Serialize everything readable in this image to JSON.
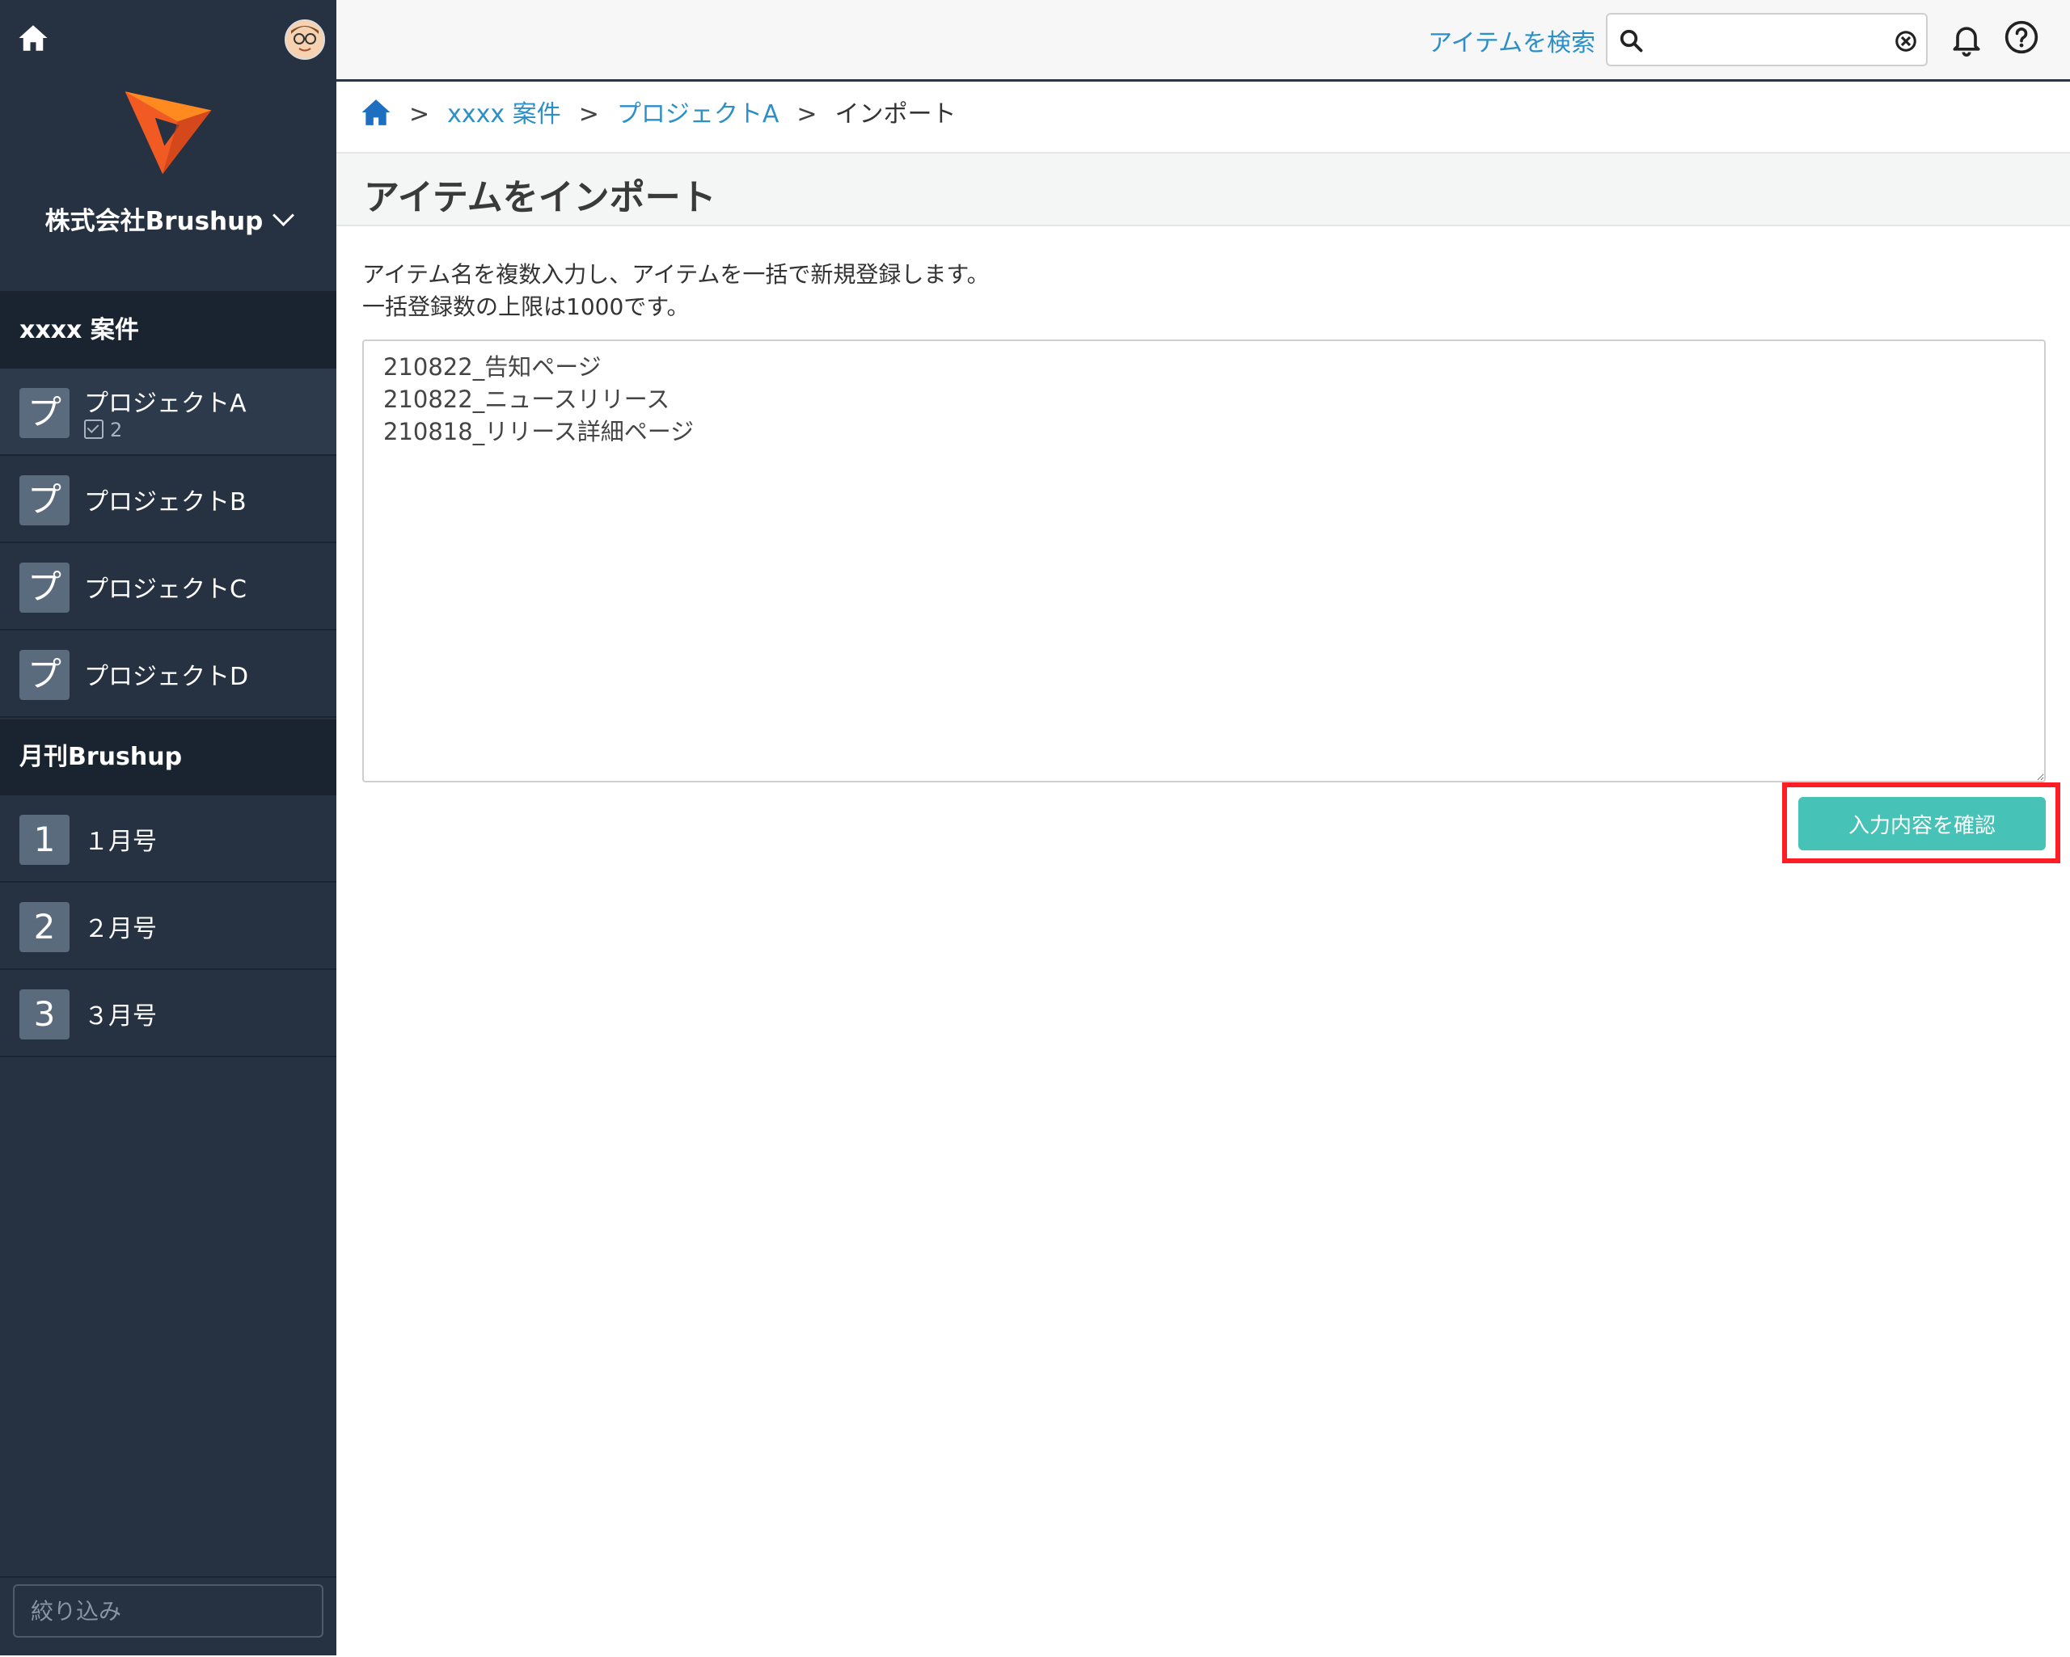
{
  "sidebar": {
    "company_name": "株式会社Brushup",
    "groups": [
      {
        "label": "xxxx 案件"
      },
      {
        "label": "月刊Brushup"
      }
    ],
    "projects": [
      {
        "badge": "プ",
        "label": "プロジェクトA",
        "task_count": "2"
      },
      {
        "badge": "プ",
        "label": "プロジェクトB"
      },
      {
        "badge": "プ",
        "label": "プロジェクトC"
      },
      {
        "badge": "プ",
        "label": "プロジェクトD"
      }
    ],
    "magazines": [
      {
        "badge": "1",
        "label": "１月号"
      },
      {
        "badge": "2",
        "label": "２月号"
      },
      {
        "badge": "3",
        "label": "３月号"
      }
    ],
    "filter_placeholder": "絞り込み"
  },
  "header": {
    "search_link": "アイテムを検索",
    "search_value": ""
  },
  "breadcrumb": {
    "items": [
      "xxxx 案件",
      "プロジェクトA"
    ],
    "current": "インポート",
    "separator": ">"
  },
  "main": {
    "title": "アイテムをインポート",
    "description_lines": [
      "アイテム名を複数入力し、アイテムを一括で新規登録します。",
      "一括登録数の上限は1000です。"
    ],
    "import_text": "210822_告知ページ\n210822_ニュースリリース\n210818_リリース詳細ページ",
    "confirm_label": "入力内容を確認"
  },
  "colors": {
    "sidebar_bg": "#263242",
    "link": "#2b8fc8",
    "confirm_button": "#46c2b6",
    "highlight": "#ff1d25"
  }
}
